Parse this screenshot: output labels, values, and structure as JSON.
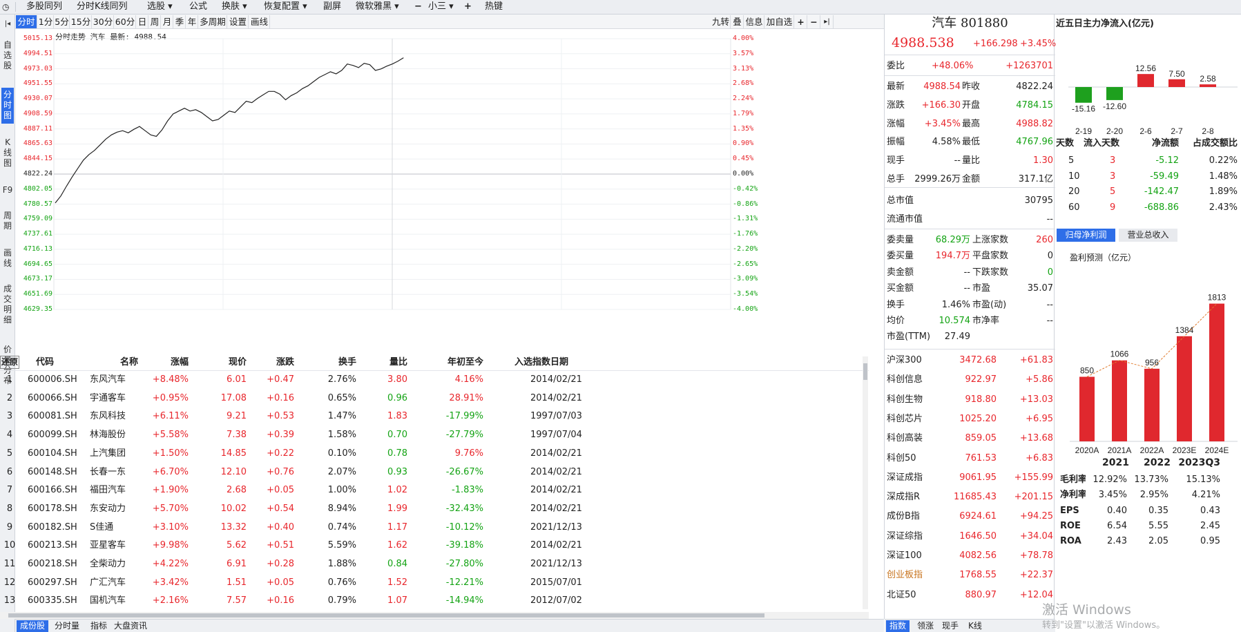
{
  "toolbar": {
    "items": [
      {
        "label": "多股同列"
      },
      {
        "label": "分时K线同列"
      },
      {
        "label": "选股 ▾"
      },
      {
        "label": "公式"
      },
      {
        "label": "换肤 ▾"
      },
      {
        "label": "恢复配置 ▾"
      },
      {
        "label": "副屏"
      },
      {
        "label": "微软雅黑 ▾"
      },
      {
        "label": "−"
      },
      {
        "label": "小三 ▾"
      },
      {
        "label": "+"
      },
      {
        "label": "热键"
      }
    ]
  },
  "left_tabs": [
    "自选股",
    "分时图",
    "K线图",
    "F9",
    "周期",
    "画线",
    "成交明细",
    "价量分布"
  ],
  "period_tabs": [
    "分时",
    "1分",
    "5分",
    "15分",
    "30分",
    "60分",
    "日",
    "周",
    "月",
    "季",
    "年",
    "多周期",
    "设置",
    "画线"
  ],
  "chart_tools": [
    "九转",
    "叠",
    "信息",
    "加自选",
    "+",
    "−",
    "▸|"
  ],
  "chart_data": {
    "type": "line",
    "title": "分时走势  汽车 最新: 4988.54",
    "prev_close": 4822.24,
    "ylim": [
      4629.35,
      5015.13
    ],
    "price_ticks": [
      "5015.13",
      "4994.51",
      "4973.03",
      "4951.55",
      "4930.07",
      "4908.59",
      "4887.11",
      "4865.63",
      "4844.15",
      "4822.24",
      "4802.05",
      "4780.57",
      "4759.09",
      "4737.61",
      "4716.13",
      "4694.65",
      "4673.17",
      "4651.69",
      "4629.35"
    ],
    "pct_ticks": [
      "4.00%",
      "3.57%",
      "3.13%",
      "2.68%",
      "2.24%",
      "1.79%",
      "1.35%",
      "0.90%",
      "0.45%",
      "0.00%",
      "-0.42%",
      "-0.86%",
      "-1.31%",
      "-1.76%",
      "-2.20%",
      "-2.65%",
      "-3.09%",
      "-3.54%",
      "-4.00%"
    ],
    "x_range": [
      0,
      240
    ],
    "series": [
      {
        "values": [
          [
            0,
            4781
          ],
          [
            4,
            4791
          ],
          [
            8,
            4805
          ],
          [
            12,
            4818
          ],
          [
            16,
            4830
          ],
          [
            20,
            4842
          ],
          [
            24,
            4850
          ],
          [
            28,
            4856
          ],
          [
            32,
            4864
          ],
          [
            36,
            4872
          ],
          [
            40,
            4878
          ],
          [
            44,
            4882
          ],
          [
            48,
            4884
          ],
          [
            52,
            4881
          ],
          [
            56,
            4886
          ],
          [
            60,
            4890
          ],
          [
            64,
            4884
          ],
          [
            68,
            4878
          ],
          [
            72,
            4876
          ],
          [
            76,
            4885
          ],
          [
            80,
            4898
          ],
          [
            84,
            4908
          ],
          [
            88,
            4912
          ],
          [
            92,
            4916
          ],
          [
            96,
            4912
          ],
          [
            100,
            4914
          ],
          [
            104,
            4910
          ],
          [
            108,
            4904
          ],
          [
            112,
            4898
          ],
          [
            116,
            4900
          ],
          [
            120,
            4906
          ],
          [
            124,
            4912
          ],
          [
            128,
            4910
          ],
          [
            132,
            4918
          ],
          [
            136,
            4926
          ],
          [
            140,
            4924
          ],
          [
            144,
            4930
          ],
          [
            148,
            4935
          ],
          [
            152,
            4940
          ],
          [
            156,
            4940
          ],
          [
            160,
            4936
          ],
          [
            164,
            4928
          ],
          [
            168,
            4934
          ],
          [
            172,
            4938
          ],
          [
            176,
            4944
          ],
          [
            180,
            4948
          ],
          [
            184,
            4954
          ],
          [
            188,
            4960
          ],
          [
            192,
            4964
          ],
          [
            196,
            4968
          ],
          [
            200,
            4965
          ],
          [
            204,
            4970
          ],
          [
            208,
            4979
          ],
          [
            212,
            4977
          ],
          [
            216,
            4974
          ],
          [
            220,
            4980
          ],
          [
            224,
            4978
          ],
          [
            228,
            4970
          ],
          [
            232,
            4972
          ],
          [
            236,
            4976
          ],
          [
            240,
            4979
          ],
          [
            244,
            4983
          ],
          [
            248,
            4988
          ]
        ]
      }
    ]
  },
  "table": {
    "headers": [
      "还原",
      "代码",
      "名称",
      "涨幅",
      "现价",
      "涨跌",
      "换手",
      "量比",
      "年初至今",
      "入选指数日期"
    ],
    "rows": [
      {
        "no": "1",
        "code": "600006.SH",
        "name": "东风汽车",
        "pct": "+8.48%",
        "price": "6.01",
        "chg": "+0.47",
        "turn": "2.76%",
        "vr": "3.80",
        "ytd": "4.16%",
        "date": "2014/02/21",
        "vr_up": true,
        "ytd_up": true
      },
      {
        "no": "2",
        "code": "600066.SH",
        "name": "宇通客车",
        "pct": "+0.95%",
        "price": "17.08",
        "chg": "+0.16",
        "turn": "0.65%",
        "vr": "0.96",
        "ytd": "28.91%",
        "date": "2014/02/21",
        "vr_up": false,
        "ytd_up": true
      },
      {
        "no": "3",
        "code": "600081.SH",
        "name": "东风科技",
        "pct": "+6.11%",
        "price": "9.21",
        "chg": "+0.53",
        "turn": "1.47%",
        "vr": "1.83",
        "ytd": "-17.99%",
        "date": "1997/07/03",
        "vr_up": true,
        "ytd_up": false
      },
      {
        "no": "4",
        "code": "600099.SH",
        "name": "林海股份",
        "pct": "+5.58%",
        "price": "7.38",
        "chg": "+0.39",
        "turn": "1.58%",
        "vr": "0.70",
        "ytd": "-27.79%",
        "date": "1997/07/04",
        "vr_up": false,
        "ytd_up": false
      },
      {
        "no": "5",
        "code": "600104.SH",
        "name": "上汽集团",
        "pct": "+1.50%",
        "price": "14.85",
        "chg": "+0.22",
        "turn": "0.10%",
        "vr": "0.78",
        "ytd": "9.76%",
        "date": "2014/02/21",
        "vr_up": false,
        "ytd_up": true
      },
      {
        "no": "6",
        "code": "600148.SH",
        "name": "长春一东",
        "pct": "+6.70%",
        "price": "12.10",
        "chg": "+0.76",
        "turn": "2.07%",
        "vr": "0.93",
        "ytd": "-26.67%",
        "date": "2014/02/21",
        "vr_up": false,
        "ytd_up": false
      },
      {
        "no": "7",
        "code": "600166.SH",
        "name": "福田汽车",
        "pct": "+1.90%",
        "price": "2.68",
        "chg": "+0.05",
        "turn": "1.00%",
        "vr": "1.02",
        "ytd": "-1.83%",
        "date": "2014/02/21",
        "vr_up": true,
        "ytd_up": false
      },
      {
        "no": "8",
        "code": "600178.SH",
        "name": "东安动力",
        "pct": "+5.70%",
        "price": "10.02",
        "chg": "+0.54",
        "turn": "8.94%",
        "vr": "1.99",
        "ytd": "-32.43%",
        "date": "2014/02/21",
        "vr_up": true,
        "ytd_up": false
      },
      {
        "no": "9",
        "code": "600182.SH",
        "name": "S佳通",
        "pct": "+3.10%",
        "price": "13.32",
        "chg": "+0.40",
        "turn": "0.74%",
        "vr": "1.17",
        "ytd": "-10.12%",
        "date": "2021/12/13",
        "vr_up": true,
        "ytd_up": false
      },
      {
        "no": "10",
        "code": "600213.SH",
        "name": "亚星客车",
        "pct": "+9.98%",
        "price": "5.62",
        "chg": "+0.51",
        "turn": "5.59%",
        "vr": "1.62",
        "ytd": "-39.18%",
        "date": "2014/02/21",
        "vr_up": true,
        "ytd_up": false
      },
      {
        "no": "11",
        "code": "600218.SH",
        "name": "全柴动力",
        "pct": "+4.22%",
        "price": "6.91",
        "chg": "+0.28",
        "turn": "1.88%",
        "vr": "0.84",
        "ytd": "-27.80%",
        "date": "2021/12/13",
        "vr_up": false,
        "ytd_up": false
      },
      {
        "no": "12",
        "code": "600297.SH",
        "name": "广汇汽车",
        "pct": "+3.42%",
        "price": "1.51",
        "chg": "+0.05",
        "turn": "0.76%",
        "vr": "1.52",
        "ytd": "-12.21%",
        "date": "2015/07/01",
        "vr_up": true,
        "ytd_up": false
      },
      {
        "no": "13",
        "code": "600335.SH",
        "name": "国机汽车",
        "pct": "+2.16%",
        "price": "7.57",
        "chg": "+0.16",
        "turn": "0.79%",
        "vr": "1.07",
        "ytd": "-14.94%",
        "date": "2012/07/02",
        "vr_up": true,
        "ytd_up": false
      }
    ]
  },
  "bottom_tabs": [
    "成份股",
    "分时量",
    "指标",
    "大盘资讯"
  ],
  "quote": {
    "name": "汽车 801880",
    "price": "4988.538",
    "change": "+166.298",
    "change_pct": "+3.45%",
    "ratio_label": "委比",
    "ratio": "+48.06%",
    "ratio_val": "+1263701",
    "pairs": [
      [
        "最新",
        "4988.54",
        "昨收",
        "4822.24",
        "red",
        "blk"
      ],
      [
        "涨跌",
        "+166.30",
        "开盘",
        "4784.15",
        "red",
        "green"
      ],
      [
        "涨幅",
        "+3.45%",
        "最高",
        "4988.82",
        "red",
        "red"
      ],
      [
        "振幅",
        "4.58%",
        "最低",
        "4767.96",
        "blk",
        "green"
      ],
      [
        "现手",
        "--",
        "量比",
        "1.30",
        "blk",
        "red"
      ],
      [
        "总手",
        "2999.26万",
        "金额",
        "317.1亿",
        "blk",
        "blk"
      ]
    ],
    "mktcap": [
      [
        "总市值",
        "30795"
      ],
      [
        "流通市值",
        "--"
      ]
    ],
    "stats": [
      [
        "委卖量",
        "68.29万",
        "上涨家数",
        "260",
        "green",
        "red"
      ],
      [
        "委买量",
        "194.7万",
        "平盘家数",
        "0",
        "red",
        "blk"
      ],
      [
        "卖金额",
        "--",
        "下跌家数",
        "0",
        "blk",
        "green"
      ],
      [
        "买金额",
        "--",
        "市盈",
        "35.07",
        "blk",
        "blk"
      ],
      [
        "换手",
        "1.46%",
        "市盈(动)",
        "--",
        "blk",
        "blk"
      ],
      [
        "均价",
        "10.574",
        "市净率",
        "--",
        "green",
        "blk"
      ],
      [
        "市盈(TTM)",
        "27.49",
        "",
        "",
        "blk",
        "blk"
      ]
    ],
    "indices": [
      [
        "沪深300",
        "3472.68",
        "+61.83"
      ],
      [
        "科创信息",
        "922.97",
        "+5.86"
      ],
      [
        "科创生物",
        "918.80",
        "+13.03"
      ],
      [
        "科创芯片",
        "1025.20",
        "+6.95"
      ],
      [
        "科创高装",
        "859.05",
        "+13.68"
      ],
      [
        "科创50",
        "761.53",
        "+6.83"
      ],
      [
        "深证成指",
        "9061.95",
        "+155.99"
      ],
      [
        "深成指R",
        "11685.43",
        "+201.15"
      ],
      [
        "成份B指",
        "6924.61",
        "+94.25"
      ],
      [
        "深证综指",
        "1646.50",
        "+34.04"
      ],
      [
        "深证100",
        "4082.56",
        "+78.78"
      ],
      [
        "创业板指",
        "1768.55",
        "+22.37"
      ],
      [
        "北证50",
        "880.97",
        "+12.04"
      ]
    ],
    "tabs": [
      "指数",
      "领涨",
      "现手",
      "K线"
    ]
  },
  "flow": {
    "title": "近五日主力净流入(亿元)",
    "days": [
      "2-19",
      "2-20",
      "2-6",
      "2-7",
      "2-8"
    ],
    "values": [
      -15.16,
      -12.6,
      12.56,
      7.5,
      2.58
    ],
    "value_labels": [
      "-15.16",
      "-12.60",
      "12.56",
      "7.50",
      "2.58"
    ],
    "table_headers": [
      "天数",
      "流入天数",
      "净流额",
      "占成交额比"
    ],
    "table": [
      [
        "5",
        "3",
        "-5.12",
        "0.22%"
      ],
      [
        "10",
        "3",
        "-59.49",
        "1.48%"
      ],
      [
        "20",
        "5",
        "-142.47",
        "1.89%"
      ],
      [
        "60",
        "9",
        "-688.86",
        "2.43%"
      ]
    ]
  },
  "profit": {
    "tabs": [
      "归母净利润",
      "营业总收入"
    ],
    "subtitle": "盈利预测（亿元）",
    "years": [
      "2020A",
      "2021A",
      "2022A",
      "2023E",
      "2024E"
    ],
    "values": [
      850,
      1066,
      956,
      1384,
      1813
    ],
    "value_labels": [
      "850",
      "1066",
      "956",
      "1384",
      "1813"
    ],
    "fin_headers": [
      "2021",
      "2022",
      "2023Q3"
    ],
    "fin_rows": [
      [
        "毛利率",
        "12.92%",
        "13.73%",
        "15.13%"
      ],
      [
        "净利率",
        "3.45%",
        "2.95%",
        "4.21%"
      ],
      [
        "EPS",
        "0.40",
        "0.35",
        "0.43"
      ],
      [
        "ROE",
        "6.54",
        "5.55",
        "2.45"
      ],
      [
        "ROA",
        "2.43",
        "2.05",
        "0.95"
      ]
    ]
  },
  "watermark": {
    "line1": "激活 Windows",
    "line2": "转到\"设置\"以激活 Windows。"
  },
  "colors": {
    "up": "#e8262c",
    "down": "#13a313",
    "accent": "#2e6ee8",
    "bar_up": "#e0282e",
    "bar_down": "#1ea01e"
  }
}
